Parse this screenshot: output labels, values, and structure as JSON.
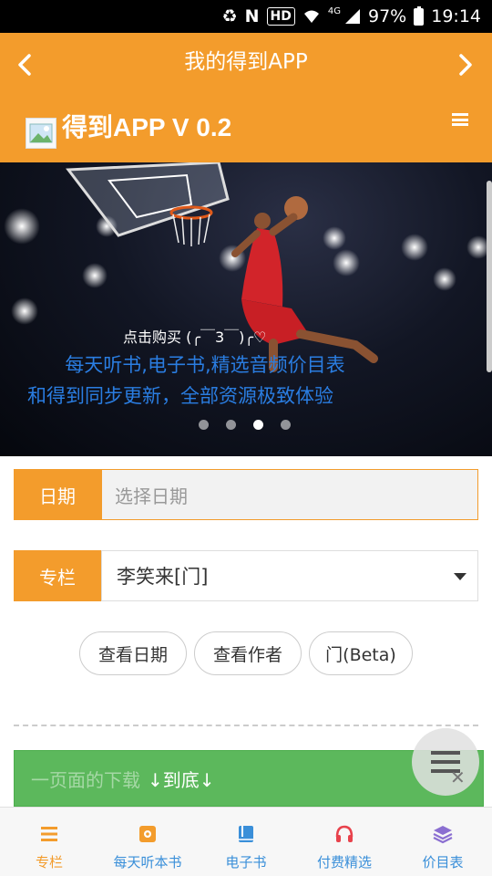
{
  "status_bar": {
    "hd": "HD",
    "network": "4G",
    "battery": "97%",
    "time": "19:14"
  },
  "header": {
    "title": "我的得到APP",
    "brand": "得到APP V 0.2"
  },
  "hero": {
    "buy_text": "点击购买 (╭￣3￣)╭♡",
    "line1": "每天听书,电子书,精选音频价目表",
    "line2": "和得到同步更新，全部资源极致体验"
  },
  "form": {
    "date": {
      "label": "日期",
      "placeholder": "选择日期"
    },
    "column": {
      "label": "专栏",
      "value": "李笑来[门]"
    }
  },
  "buttons": {
    "view_date": "查看日期",
    "view_author": "查看作者",
    "door_beta": "门(Beta)"
  },
  "bottom_bar": {
    "faded": "一页面的下载",
    "to_bottom": "↓到底↓"
  },
  "tabs": [
    {
      "label": "专栏",
      "color": "#f39c2c"
    },
    {
      "label": "每天听本书",
      "color": "#3a8fd9"
    },
    {
      "label": "电子书",
      "color": "#3a8fd9"
    },
    {
      "label": "付费精选",
      "color": "#3a8fd9"
    },
    {
      "label": "价目表",
      "color": "#3a8fd9"
    }
  ],
  "colors": {
    "accent": "#f39c2c",
    "success": "#5cb85c",
    "link": "#2a7de1"
  }
}
